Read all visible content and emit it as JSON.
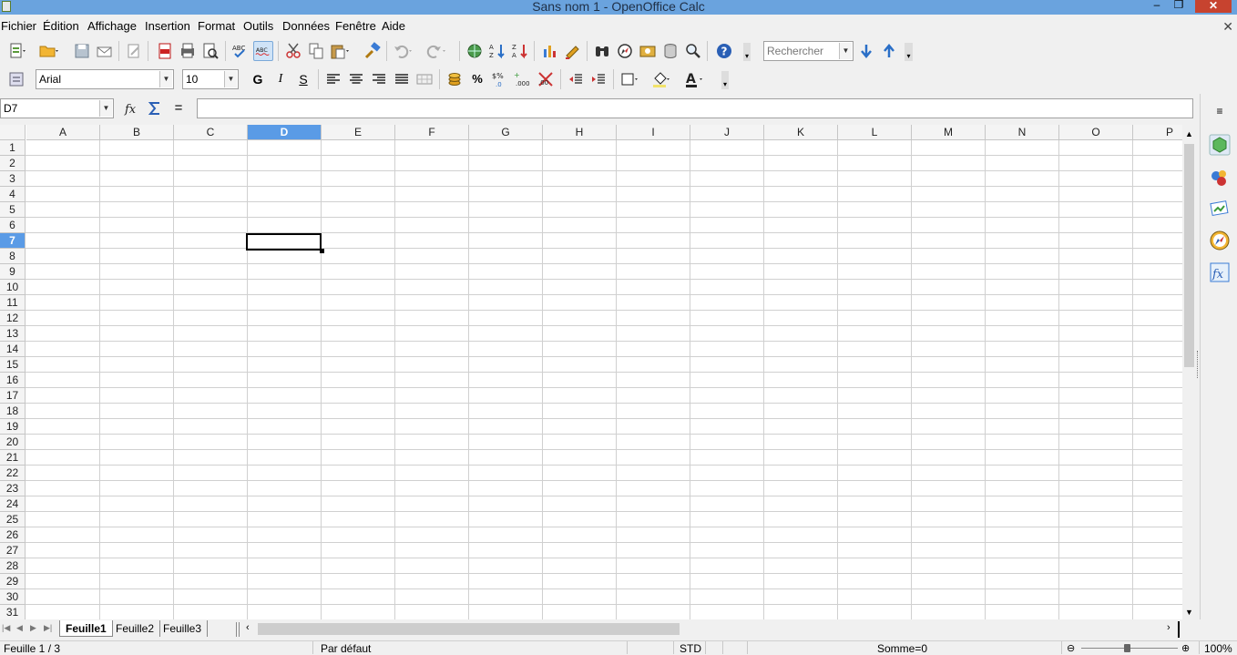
{
  "window": {
    "title": "Sans nom 1 - OpenOffice Calc"
  },
  "menu": {
    "items": [
      "Fichier",
      "Édition",
      "Affichage",
      "Insertion",
      "Format",
      "Outils",
      "Données",
      "Fenêtre",
      "Aide"
    ],
    "close_glyph": "✕"
  },
  "standard_toolbar": {
    "search_placeholder": "Rechercher"
  },
  "format_toolbar": {
    "font_name": "Arial",
    "font_size": "10",
    "bold_label": "G",
    "italic_label": "I",
    "underline_label": "S"
  },
  "formula_bar": {
    "name_box": "D7",
    "equals_label": "=",
    "formula": ""
  },
  "grid": {
    "columns": [
      "A",
      "B",
      "C",
      "D",
      "E",
      "F",
      "G",
      "H",
      "I",
      "J",
      "K",
      "L",
      "M",
      "N",
      "O",
      "P"
    ],
    "rows": [
      "1",
      "2",
      "3",
      "4",
      "5",
      "6",
      "7",
      "8",
      "9",
      "10",
      "11",
      "12",
      "13",
      "14",
      "15",
      "16",
      "17",
      "18",
      "19",
      "20",
      "21",
      "22",
      "23",
      "24",
      "25",
      "26",
      "27",
      "28",
      "29",
      "30",
      "31"
    ],
    "active_column": "D",
    "active_row": "7"
  },
  "sheets": {
    "tabs": [
      "Feuille1",
      "Feuille2",
      "Feuille3"
    ],
    "active": "Feuille1"
  },
  "status": {
    "sheet_info": "Feuille 1 / 3",
    "page_style": "Par défaut",
    "mode": "STD",
    "sum": "Somme=0",
    "zoom": "100%"
  },
  "colors": {
    "titlebar": "#6aa3de",
    "selection_header": "#5a9be6",
    "close_button": "#c7432f"
  }
}
